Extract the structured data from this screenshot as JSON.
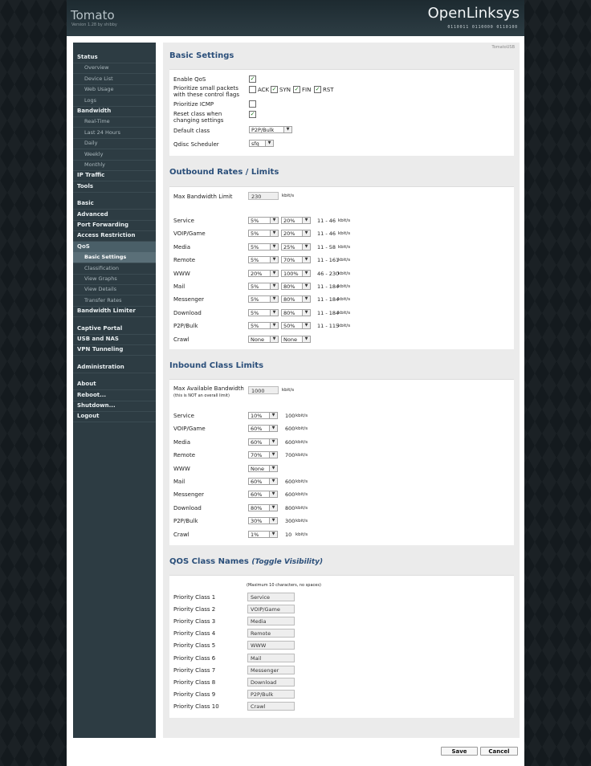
{
  "header": {
    "app_title": "Tomato",
    "version": "Version 1.28 by shibby",
    "brand": "OpenLinksys",
    "binary_tag": "0110011 0110000 0110100"
  },
  "sidebar": {
    "items": [
      {
        "label": "Status",
        "level": "top"
      },
      {
        "label": "Overview",
        "level": "sub"
      },
      {
        "label": "Device List",
        "level": "sub"
      },
      {
        "label": "Web Usage",
        "level": "sub"
      },
      {
        "label": "Logs",
        "level": "sub"
      },
      {
        "label": "Bandwidth",
        "level": "top"
      },
      {
        "label": "Real-Time",
        "level": "sub"
      },
      {
        "label": "Last 24 Hours",
        "level": "sub"
      },
      {
        "label": "Daily",
        "level": "sub"
      },
      {
        "label": "Weekly",
        "level": "sub"
      },
      {
        "label": "Monthly",
        "level": "sub"
      },
      {
        "label": "IP Traffic",
        "level": "top"
      },
      {
        "label": "Tools",
        "level": "top"
      },
      {
        "label": "Basic",
        "level": "top"
      },
      {
        "label": "Advanced",
        "level": "top"
      },
      {
        "label": "Port Forwarding",
        "level": "top"
      },
      {
        "label": "Access Restriction",
        "level": "top"
      },
      {
        "label": "QoS",
        "level": "top",
        "active": true
      },
      {
        "label": "Basic Settings",
        "level": "sub",
        "active": true
      },
      {
        "label": "Classification",
        "level": "sub"
      },
      {
        "label": "View Graphs",
        "level": "sub"
      },
      {
        "label": "View Details",
        "level": "sub"
      },
      {
        "label": "Transfer Rates",
        "level": "sub"
      },
      {
        "label": "Bandwidth Limiter",
        "level": "top"
      },
      {
        "label": "Captive Portal",
        "level": "top"
      },
      {
        "label": "USB and NAS",
        "level": "top"
      },
      {
        "label": "VPN Tunneling",
        "level": "top"
      },
      {
        "label": "Administration",
        "level": "top"
      },
      {
        "label": "About",
        "level": "top"
      },
      {
        "label": "Reboot...",
        "level": "top"
      },
      {
        "label": "Shutdown...",
        "level": "top"
      },
      {
        "label": "Logout",
        "level": "top"
      }
    ]
  },
  "content": {
    "top_label": "TomatoUSB",
    "basic": {
      "title": "Basic Settings",
      "enable_qos_label": "Enable QoS",
      "enable_qos": true,
      "prioritize_label": "Prioritize small packets\nwith these control flags",
      "flags": [
        {
          "label": "ACK",
          "checked": false
        },
        {
          "label": "SYN",
          "checked": true
        },
        {
          "label": "FIN",
          "checked": true
        },
        {
          "label": "RST",
          "checked": true
        }
      ],
      "icmp_label": "Prioritize ICMP",
      "icmp": false,
      "reset_label": "Reset class when\nchanging settings",
      "reset": true,
      "default_class_label": "Default class",
      "default_class": "P2P/Bulk",
      "scheduler_label": "Qdisc Scheduler",
      "scheduler": "sfq"
    },
    "outbound": {
      "title": "Outbound Rates / Limits",
      "max_bw_label": "Max Bandwidth Limit",
      "max_bw": "230",
      "unit": "kbit/s",
      "rows": [
        {
          "name": "Service",
          "min": "5%",
          "max": "20%",
          "range": "11 - 46",
          "unit": "kbit/s"
        },
        {
          "name": "VOIP/Game",
          "min": "5%",
          "max": "20%",
          "range": "11 - 46",
          "unit": "kbit/s"
        },
        {
          "name": "Media",
          "min": "5%",
          "max": "25%",
          "range": "11 - 58",
          "unit": "kbit/s"
        },
        {
          "name": "Remote",
          "min": "5%",
          "max": "70%",
          "range": "11 - 161",
          "unit": "kbit/s"
        },
        {
          "name": "WWW",
          "min": "20%",
          "max": "100%",
          "range": "46 - 230",
          "unit": "kbit/s"
        },
        {
          "name": "Mail",
          "min": "5%",
          "max": "80%",
          "range": "11 - 184",
          "unit": "kbit/s"
        },
        {
          "name": "Messenger",
          "min": "5%",
          "max": "80%",
          "range": "11 - 184",
          "unit": "kbit/s"
        },
        {
          "name": "Download",
          "min": "5%",
          "max": "80%",
          "range": "11 - 184",
          "unit": "kbit/s"
        },
        {
          "name": "P2P/Bulk",
          "min": "5%",
          "max": "50%",
          "range": "11 - 115",
          "unit": "kbit/s"
        },
        {
          "name": "Crawl",
          "min": "None",
          "max": "None",
          "range": "",
          "unit": ""
        }
      ]
    },
    "inbound": {
      "title": "Inbound Class Limits",
      "max_bw_label": "Max Available Bandwidth",
      "max_bw_note": "(this is NOT an overall limit)",
      "max_bw": "1000",
      "unit": "kbit/s",
      "rows": [
        {
          "name": "Service",
          "pct": "10%",
          "rate": "100",
          "unit": "kbit/s"
        },
        {
          "name": "VOIP/Game",
          "pct": "60%",
          "rate": "600",
          "unit": "kbit/s"
        },
        {
          "name": "Media",
          "pct": "60%",
          "rate": "600",
          "unit": "kbit/s"
        },
        {
          "name": "Remote",
          "pct": "70%",
          "rate": "700",
          "unit": "kbit/s"
        },
        {
          "name": "WWW",
          "pct": "None",
          "rate": "",
          "unit": ""
        },
        {
          "name": "Mail",
          "pct": "60%",
          "rate": "600",
          "unit": "kbit/s"
        },
        {
          "name": "Messenger",
          "pct": "60%",
          "rate": "600",
          "unit": "kbit/s"
        },
        {
          "name": "Download",
          "pct": "80%",
          "rate": "800",
          "unit": "kbit/s"
        },
        {
          "name": "P2P/Bulk",
          "pct": "30%",
          "rate": "300",
          "unit": "kbit/s"
        },
        {
          "name": "Crawl",
          "pct": "1%",
          "rate": "10",
          "unit": "kbit/s"
        }
      ]
    },
    "names": {
      "title": "QOS Class Names",
      "toggle": "(Toggle Visibility)",
      "note": "(Maximum 10 characters, no spaces)",
      "rows": [
        {
          "label": "Priority Class 1",
          "value": "Service"
        },
        {
          "label": "Priority Class 2",
          "value": "VOIP/Game"
        },
        {
          "label": "Priority Class 3",
          "value": "Media"
        },
        {
          "label": "Priority Class 4",
          "value": "Remote"
        },
        {
          "label": "Priority Class 5",
          "value": "WWW"
        },
        {
          "label": "Priority Class 6",
          "value": "Mail"
        },
        {
          "label": "Priority Class 7",
          "value": "Messenger"
        },
        {
          "label": "Priority Class 8",
          "value": "Download"
        },
        {
          "label": "Priority Class 9",
          "value": "P2P/Bulk"
        },
        {
          "label": "Priority Class 10",
          "value": "Crawl"
        }
      ]
    },
    "buttons": {
      "save": "Save",
      "cancel": "Cancel"
    }
  }
}
